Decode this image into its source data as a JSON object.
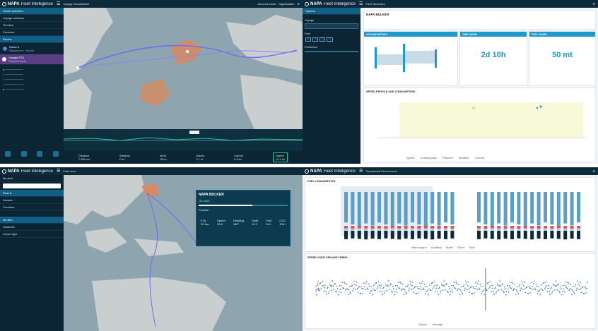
{
  "app": {
    "brand": "NAPA",
    "brand_suffix": "Fleet Intelligence"
  },
  "q1": {
    "title": "Voyage Visualization",
    "user": "Account name · Organization",
    "sidebar_items": [
      "Vessel selection",
      "Voyage selection",
      "Timeline",
      "Favorites"
    ],
    "route_items": [
      {
        "label": "Route A",
        "detail": "Depart port · Arrival"
      },
      {
        "label": "Voyage ETA",
        "detail": "Planned route"
      }
    ],
    "selected_section": "Routes",
    "bottom_stats": [
      {
        "k": "Distance",
        "v": "7 580 nm"
      },
      {
        "k": "Weather",
        "v": "Fair"
      },
      {
        "k": "Wind",
        "v": "15 kn"
      },
      {
        "k": "Waves",
        "v": "2.1 m"
      },
      {
        "k": "Current",
        "v": "0.6 kn"
      },
      {
        "k": "Speed",
        "v": "13.1 kn"
      }
    ]
  },
  "q2": {
    "title": "Fleet Summary",
    "vessel": "NAPA BULKER",
    "options": [
      "Options",
      "Voyage",
      "Fuel",
      "Emissions"
    ],
    "cards": [
      {
        "title": "VOYAGE DETAILS",
        "value": ""
      },
      {
        "title": "TIME SAVED",
        "value": "2d 10h"
      },
      {
        "title": "FUEL SAVED",
        "value": "50 mt"
      }
    ],
    "chart_title": "SPEED PROFILE AND CONSUMPTION",
    "legend": [
      "Speed",
      "Consumption",
      "Planned",
      "Weather",
      "Current"
    ]
  },
  "q3": {
    "title": "Fleet view",
    "sidebar_items": [
      "My fleet",
      "Fleet A",
      "Vessels",
      "Favorites",
      "My filter",
      "Subfleets",
      "Vessel type"
    ],
    "vessel_card": {
      "name": "NAPA BULKER",
      "subtitle": "On route",
      "position_label": "Position",
      "stats": [
        {
          "k": "ETA",
          "v": "12 Jan"
        },
        {
          "k": "Speed",
          "v": "12.8"
        },
        {
          "k": "Heading",
          "v": "180°"
        },
        {
          "k": "Draft",
          "v": "11.2"
        },
        {
          "k": "Fuel",
          "v": "34 t"
        },
        {
          "k": "CO2",
          "v": "108 t"
        }
      ]
    }
  },
  "q4": {
    "title": "Operational Performance",
    "chart1_title": "FUEL CONSUMPTION",
    "chart1_legend": [
      "Main engine",
      "Auxiliary",
      "Boiler",
      "Other",
      "Total"
    ],
    "chart2_title": "SPEED OVER GROUND TREND",
    "chart2_legend": [
      "Speed",
      "Average"
    ]
  },
  "colors": {
    "navy": "#0b2534",
    "accent": "#1d9acb",
    "orange": "#e0784a",
    "route": "#6d6cf0"
  }
}
